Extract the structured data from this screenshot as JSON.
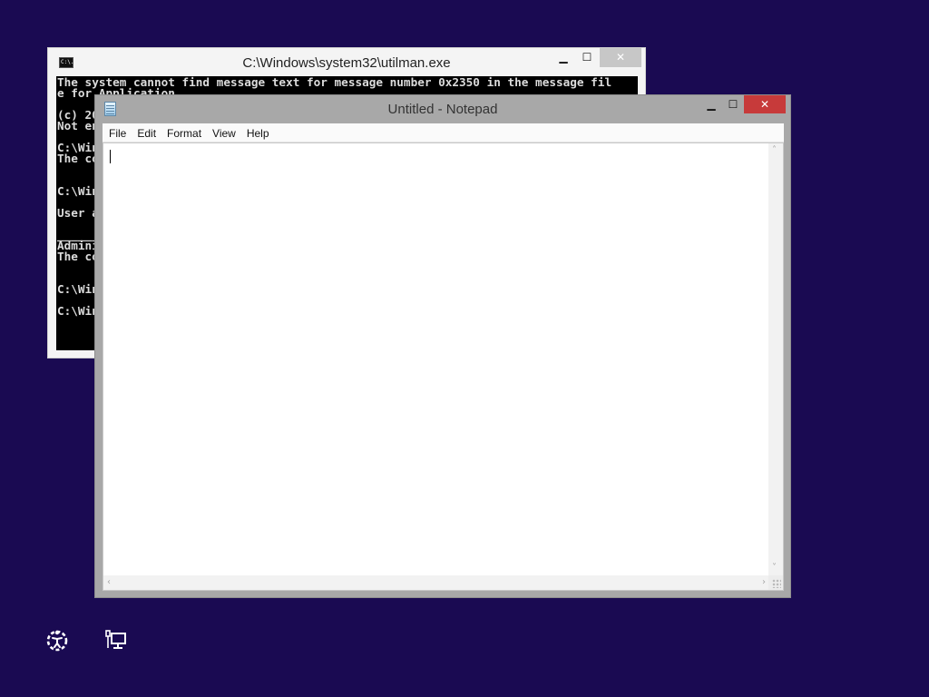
{
  "cmd_window": {
    "title": "C:\\Windows\\system32\\utilman.exe",
    "icon_label": "C:\\.",
    "controls": {
      "minimize": "▁",
      "maximize": "☐",
      "close": "✕"
    },
    "console_lines": [
      "The system cannot find message text for message number 0x2350 in the message fil",
      "e for Application",
      "",
      "(c) 20",
      "Not en",
      "",
      "C:\\Win",
      "The co",
      "",
      "",
      "C:\\Win",
      "",
      "User a",
      "",
      "______",
      "Admini",
      "The co",
      "",
      "",
      "C:\\Win",
      "",
      "C:\\Win"
    ]
  },
  "notepad_window": {
    "title": "Untitled - Notepad",
    "controls": {
      "minimize": "▁",
      "maximize": "☐",
      "close": "✕"
    },
    "menu": [
      "File",
      "Edit",
      "Format",
      "View",
      "Help"
    ],
    "content": ""
  },
  "taskbar_icons": [
    "ease-of-access-icon",
    "network-icon"
  ],
  "colors": {
    "desktop_background": "#1a0a52",
    "notepad_close": "#c73a3a"
  }
}
